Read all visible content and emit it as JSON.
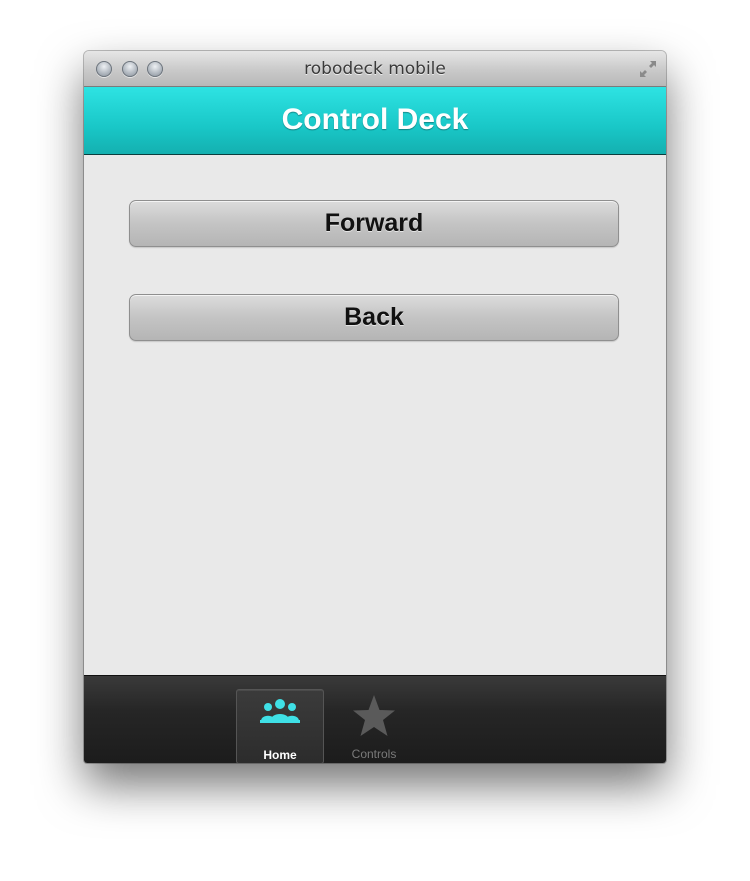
{
  "window": {
    "title": "robodeck mobile",
    "controls": [
      "close-button",
      "minimize-button",
      "zoom-button"
    ],
    "resize_icon": "fullscreen-icon"
  },
  "header": {
    "title": "Control Deck",
    "color": "#1fd4d4"
  },
  "buttons": {
    "forward_label": "Forward",
    "back_label": "Back"
  },
  "tabbar": {
    "tabs": [
      {
        "label": "Home",
        "icon": "people-icon",
        "active": true,
        "icon_color": "#3fe0e6"
      },
      {
        "label": "Controls",
        "icon": "star-icon",
        "active": false,
        "icon_color": "#5a5a5a"
      }
    ]
  }
}
